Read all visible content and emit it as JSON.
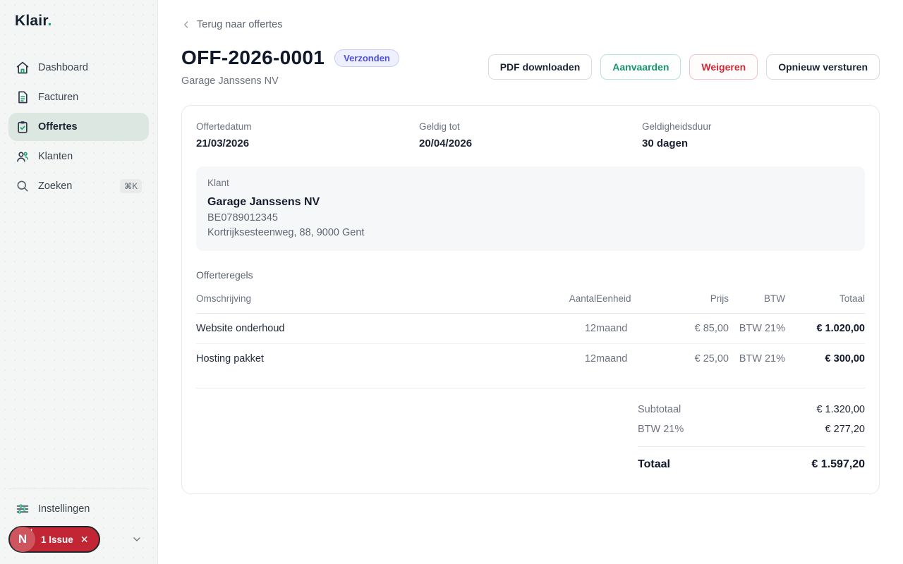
{
  "brand": {
    "name": "Klair",
    "dot": "."
  },
  "sidebar": {
    "items": [
      {
        "label": "Dashboard"
      },
      {
        "label": "Facturen"
      },
      {
        "label": "Offertes"
      },
      {
        "label": "Klanten"
      },
      {
        "label": "Zoeken",
        "kbd": "⌘K"
      }
    ],
    "settings_label": "Instellingen",
    "issue_badge": {
      "letter": "N",
      "label": "1 Issue",
      "close": "✕"
    }
  },
  "header": {
    "back_label": "Terug naar offertes",
    "title": "OFF-2026-0001",
    "status": "Verzonden",
    "subtitle": "Garage Janssens NV",
    "buttons": [
      {
        "label": "PDF downloaden"
      },
      {
        "label": "Aanvaarden"
      },
      {
        "label": "Weigeren"
      },
      {
        "label": "Opnieuw versturen"
      }
    ]
  },
  "card": {
    "meta": [
      {
        "label": "Offertedatum",
        "value": "21/03/2026"
      },
      {
        "label": "Geldig tot",
        "value": "20/04/2026"
      },
      {
        "label": "Geldigheidsduur",
        "value": "30 dagen"
      }
    ],
    "client": {
      "label": "Klant",
      "name": "Garage Janssens NV",
      "vat": "BE0789012345",
      "address": "Kortrijksesteenweg, 88, 9000 Gent"
    },
    "lines": {
      "section_label": "Offerteregels",
      "columns": {
        "description": "Omschrijving",
        "qty": "Aantal",
        "unit": "Eenheid",
        "price": "Prijs",
        "vat": "BTW",
        "total": "Totaal"
      },
      "rows": [
        {
          "description": "Website onderhoud",
          "qty": "12",
          "unit": "maand",
          "price": "€ 85,00",
          "vat": "BTW 21%",
          "total": "€ 1.020,00"
        },
        {
          "description": "Hosting pakket",
          "qty": "12",
          "unit": "maand",
          "price": "€ 25,00",
          "vat": "BTW 21%",
          "total": "€ 300,00"
        }
      ]
    },
    "totals": {
      "subtotal_label": "Subtotaal",
      "subtotal_value": "€ 1.320,00",
      "vat_label": "BTW 21%",
      "vat_value": "€ 277,20",
      "total_label": "Totaal",
      "total_value": "€ 1.597,20"
    }
  },
  "colors": {
    "accent_green": "#1a9e6c",
    "status_indigo": "#4d50dc",
    "danger_red": "#cc2936",
    "issue_badge_red": "#c22533",
    "sidebar_active_bg": "#dce7e1"
  }
}
